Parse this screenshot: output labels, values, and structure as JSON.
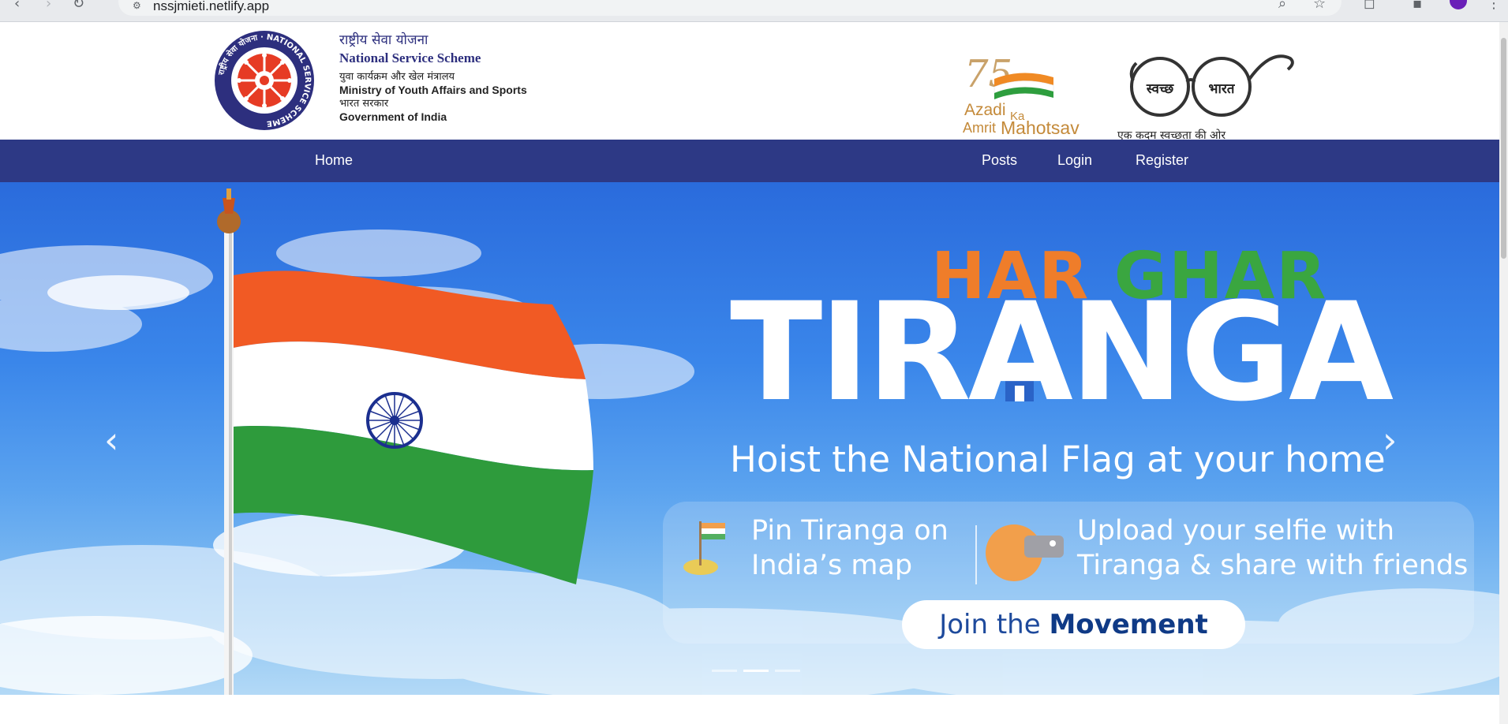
{
  "browser": {
    "url": "nssjmieti.netlify.app"
  },
  "header": {
    "nss_hindi_title": "राष्ट्रीय सेवा योजना",
    "nss_title": "National Service Scheme",
    "ministry_hindi": "युवा कार्यक्रम और खेल मंत्रालय",
    "ministry": "Ministry of Youth Affairs and Sports",
    "bharat_sarkar": "भारत सरकार",
    "government": "Government of India",
    "nss_logo_ring_text": "राष्ट्रीय सेवा योजना · NATIONAL SERVICE SCHEME",
    "azadi_logo": {
      "number": "75",
      "line1": "Azadi",
      "ka": "Ka",
      "line2": "Amrit",
      "line3": "Mahotsav"
    },
    "swachh_logo": {
      "left_lens": "स्वच्छ",
      "right_lens": "भारत",
      "tagline": "एक कदम स्वच्छता की ओर"
    }
  },
  "navbar": {
    "home": "Home",
    "posts": "Posts",
    "login": "Login",
    "register": "Register",
    "background": "#2d3985"
  },
  "hero": {
    "har": "HAR",
    "ghar": "GHAR",
    "tiranga": "TIRANGA",
    "hoist": "Hoist the National Flag at your home",
    "pin_line1": "Pin Tiranga on",
    "pin_line2": "India’s map",
    "upload_line1": "Upload your selfie with",
    "upload_line2": "Tiranga & share with friends",
    "join_prefix": "Join the",
    "join_bold": "Movement",
    "prev_icon": "chevron-left-icon",
    "next_icon": "chevron-right-icon",
    "slide_count": 3,
    "active_slide": 2,
    "colors": {
      "saffron": "#ef7d2a",
      "green": "#3aa640",
      "white": "#ffffff"
    }
  }
}
